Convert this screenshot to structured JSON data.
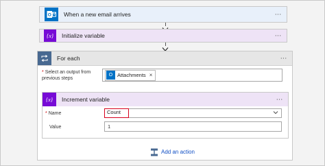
{
  "flow": {
    "trigger": {
      "title": "When a new email arrives",
      "icon": "outlook-icon",
      "menu": "···"
    },
    "initialize": {
      "title": "Initialize variable",
      "icon": "variable-icon",
      "menu": "···"
    },
    "foreach": {
      "title": "For each",
      "icon": "loop-icon",
      "menu": "···",
      "select_label": "Select an output from previous steps",
      "required_mark": "*",
      "token": {
        "text": "Attachments",
        "icon": "outlook-icon",
        "remove": "×"
      },
      "increment": {
        "title": "Increment variable",
        "icon": "variable-icon",
        "menu": "···",
        "name_label": "Name",
        "name_value": "Count",
        "value_label": "Value",
        "value_value": "1"
      },
      "add_action_label": "Add an action"
    }
  },
  "colors": {
    "outlook_blue": "#0072c6",
    "variable_purple": "#770bd6",
    "loop_blue": "#486991",
    "highlight_red": "#d6001c",
    "link_blue": "#0f4ec4"
  }
}
